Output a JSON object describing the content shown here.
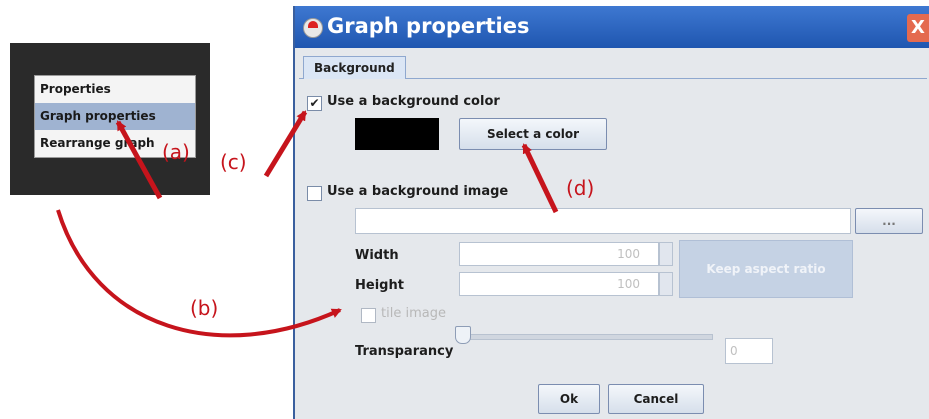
{
  "context_menu": {
    "items": [
      {
        "label": "Properties",
        "selected": false
      },
      {
        "label": "Graph properties",
        "selected": true
      },
      {
        "label": "Rearrange graph",
        "selected": false
      }
    ]
  },
  "dialog": {
    "title": "Graph properties",
    "close_label": "X",
    "tab_label": "Background",
    "use_bg_color": {
      "label": "Use a background color",
      "checked": true,
      "mark": "✔"
    },
    "color_swatch_value": "#000000",
    "select_color_label": "Select a color",
    "use_bg_image": {
      "label": "Use a background image",
      "checked": false
    },
    "browse_label": "...",
    "width_label": "Width",
    "width_value": "100",
    "height_label": "Height",
    "height_value": "100",
    "keep_aspect_label": "Keep aspect ratio",
    "tile_image_label": "tile image",
    "transparency_label": "Transparancy",
    "transparency_value": "0",
    "ok_label": "Ok",
    "cancel_label": "Cancel"
  },
  "annotations": {
    "a": "(a)",
    "b": "(b)",
    "c": "(c)",
    "d": "(d)",
    "color": "#c6141c"
  }
}
